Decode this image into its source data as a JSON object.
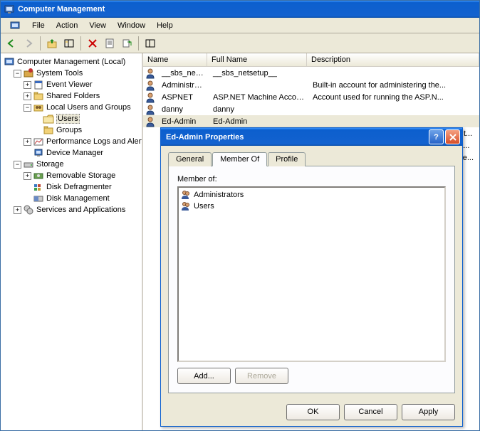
{
  "window": {
    "title": "Computer Management"
  },
  "menu": {
    "file": "File",
    "action": "Action",
    "view": "View",
    "window": "Window",
    "help": "Help"
  },
  "tree": {
    "root": "Computer Management (Local)",
    "systools": "System Tools",
    "eventviewer": "Event Viewer",
    "sharedfolders": "Shared Folders",
    "lug": "Local Users and Groups",
    "users": "Users",
    "groups": "Groups",
    "perf": "Performance Logs and Alerts",
    "devmgr": "Device Manager",
    "storage": "Storage",
    "removable": "Removable Storage",
    "defrag": "Disk Defragmenter",
    "diskmgmt": "Disk Management",
    "services": "Services and Applications"
  },
  "list": {
    "hdr_name": "Name",
    "hdr_full": "Full Name",
    "hdr_desc": "Description",
    "rows": [
      {
        "name": "__sbs_netse...",
        "full": "__sbs_netsetup__",
        "desc": ""
      },
      {
        "name": "Administrator",
        "full": "",
        "desc": "Built-in account for administering the..."
      },
      {
        "name": "ASPNET",
        "full": "ASP.NET Machine Account",
        "desc": "Account used for running the ASP.N..."
      },
      {
        "name": "danny",
        "full": "danny",
        "desc": ""
      },
      {
        "name": "Ed-Admin",
        "full": "Ed-Admin",
        "desc": ""
      }
    ],
    "covered": [
      {
        "desc": "o t..."
      },
      {
        "desc": "st..."
      },
      {
        "desc": "He..."
      }
    ]
  },
  "dialog": {
    "title": "Ed-Admin Properties",
    "tab_general": "General",
    "tab_memberof": "Member Of",
    "tab_profile": "Profile",
    "memberof_label": "Member of:",
    "members": [
      {
        "name": "Administrators"
      },
      {
        "name": "Users"
      }
    ],
    "add": "Add...",
    "remove": "Remove",
    "ok": "OK",
    "cancel": "Cancel",
    "apply": "Apply"
  }
}
